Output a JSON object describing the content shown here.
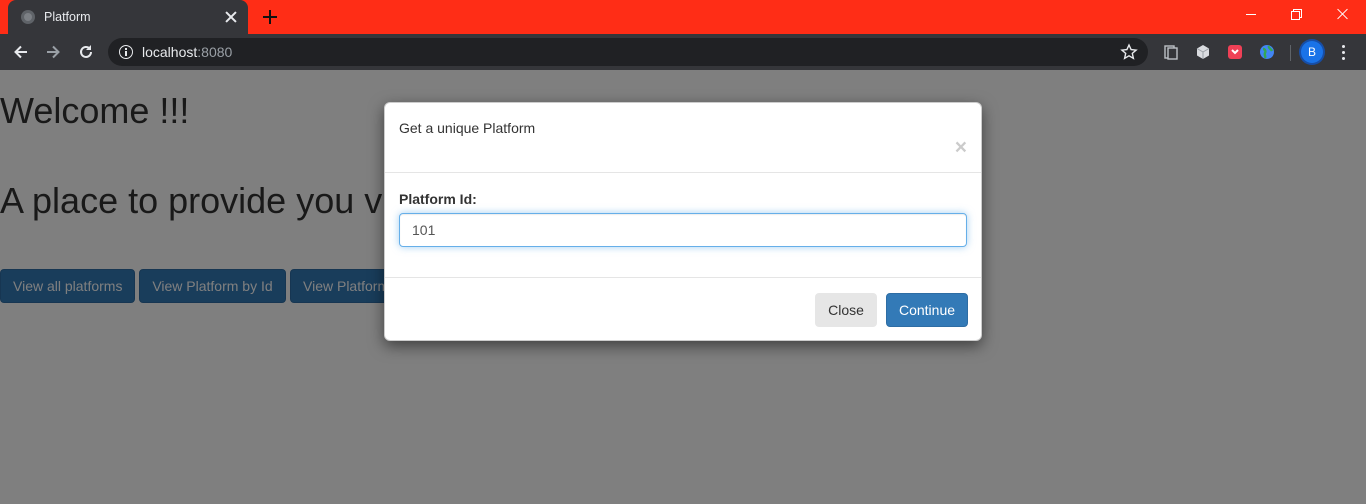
{
  "browser": {
    "tab_title": "Platform",
    "url_host": "localhost",
    "url_port": ":8080",
    "profile_initial": "B",
    "tabstrip_color": "#ff2d16"
  },
  "page": {
    "heading": "Welcome !!!",
    "subheading": "A place to provide you v",
    "buttons": [
      {
        "label": "View all platforms"
      },
      {
        "label": "View Platform by Id"
      },
      {
        "label": "View Platform"
      }
    ]
  },
  "modal": {
    "title": "Get a unique Platform",
    "close_symbol": "×",
    "field_label": "Platform Id:",
    "field_value": "101",
    "close_label": "Close",
    "continue_label": "Continue"
  }
}
